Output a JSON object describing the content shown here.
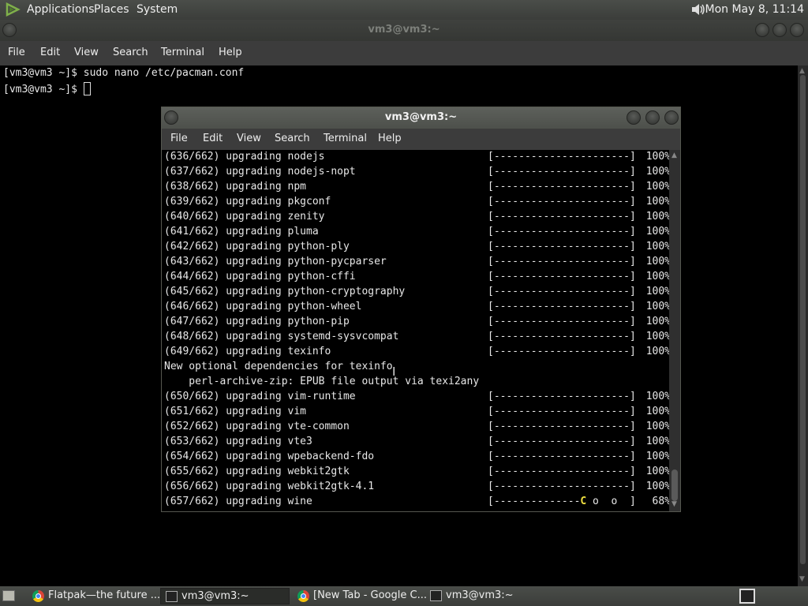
{
  "top_panel": {
    "applications": "Applications",
    "places": "Places",
    "system": "System",
    "clock": "Mon May  8, 11:14"
  },
  "outer_window": {
    "title": "vm3@vm3:~",
    "menu": [
      "File",
      "Edit",
      "View",
      "Search",
      "Terminal",
      "Help"
    ],
    "lines": [
      "[vm3@vm3 ~]$ sudo nano /etc/pacman.conf",
      "[vm3@vm3 ~]$ "
    ]
  },
  "inner_window": {
    "title": "vm3@vm3:~",
    "menu": [
      "File",
      "Edit",
      "View",
      "Search",
      "Terminal",
      "Help"
    ],
    "rows": [
      {
        "text": "(636/662) upgrading nodejs",
        "bar": "[----------------------]",
        "pct": "100%"
      },
      {
        "text": "(637/662) upgrading nodejs-nopt",
        "bar": "[----------------------]",
        "pct": "100%"
      },
      {
        "text": "(638/662) upgrading npm",
        "bar": "[----------------------]",
        "pct": "100%"
      },
      {
        "text": "(639/662) upgrading pkgconf",
        "bar": "[----------------------]",
        "pct": "100%"
      },
      {
        "text": "(640/662) upgrading zenity",
        "bar": "[----------------------]",
        "pct": "100%"
      },
      {
        "text": "(641/662) upgrading pluma",
        "bar": "[----------------------]",
        "pct": "100%"
      },
      {
        "text": "(642/662) upgrading python-ply",
        "bar": "[----------------------]",
        "pct": "100%"
      },
      {
        "text": "(643/662) upgrading python-pycparser",
        "bar": "[----------------------]",
        "pct": "100%"
      },
      {
        "text": "(644/662) upgrading python-cffi",
        "bar": "[----------------------]",
        "pct": "100%"
      },
      {
        "text": "(645/662) upgrading python-cryptography",
        "bar": "[----------------------]",
        "pct": "100%"
      },
      {
        "text": "(646/662) upgrading python-wheel",
        "bar": "[----------------------]",
        "pct": "100%"
      },
      {
        "text": "(647/662) upgrading python-pip",
        "bar": "[----------------------]",
        "pct": "100%"
      },
      {
        "text": "(648/662) upgrading systemd-sysvcompat",
        "bar": "[----------------------]",
        "pct": "100%"
      },
      {
        "text": "(649/662) upgrading texinfo",
        "bar": "[----------------------]",
        "pct": "100%"
      },
      {
        "text": "New optional dependencies for texinfo",
        "bar": "",
        "pct": ""
      },
      {
        "text": "    perl-archive-zip: EPUB file output via texi2any",
        "bar": "",
        "pct": ""
      },
      {
        "text": "(650/662) upgrading vim-runtime",
        "bar": "[----------------------]",
        "pct": "100%"
      },
      {
        "text": "(651/662) upgrading vim",
        "bar": "[----------------------]",
        "pct": "100%"
      },
      {
        "text": "(652/662) upgrading vte-common",
        "bar": "[----------------------]",
        "pct": "100%"
      },
      {
        "text": "(653/662) upgrading vte3",
        "bar": "[----------------------]",
        "pct": "100%"
      },
      {
        "text": "(654/662) upgrading wpebackend-fdo",
        "bar": "[----------------------]",
        "pct": "100%"
      },
      {
        "text": "(655/662) upgrading webkit2gtk",
        "bar": "[----------------------]",
        "pct": "100%"
      },
      {
        "text": "(656/662) upgrading webkit2gtk-4.1",
        "bar": "[----------------------]",
        "pct": "100%"
      }
    ],
    "last_row": {
      "text": "(657/662) upgrading wine",
      "bar_dashes": "[--------------",
      "pacman": "C",
      "bar_rest": " o  o  ]",
      "pct": "68%"
    }
  },
  "taskbar": {
    "tasks": [
      {
        "label": "Flatpak—the future ...",
        "icon": "chrome-icon"
      },
      {
        "label": "vm3@vm3:~",
        "icon": "terminal-icon"
      },
      {
        "label": "[New Tab - Google C...",
        "icon": "chrome-icon"
      },
      {
        "label": "vm3@vm3:~",
        "icon": "terminal-icon"
      }
    ]
  }
}
